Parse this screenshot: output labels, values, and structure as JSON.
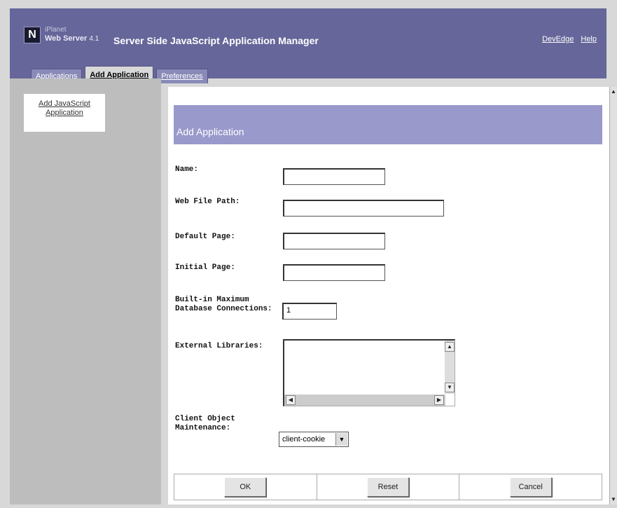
{
  "header": {
    "logo_letter": "N",
    "product_line1": "iPlanet",
    "product_line2": "Web Server",
    "product_version": "4.1",
    "app_title": "Server Side JavaScript Application Manager",
    "links": {
      "devedge": "DevEdge",
      "help": "Help"
    }
  },
  "tabs": [
    {
      "label": "Applications",
      "active": false
    },
    {
      "label": "Add Application",
      "active": true
    },
    {
      "label": "Preferences",
      "active": false
    }
  ],
  "sidebar": {
    "items": [
      {
        "label": "Add JavaScript Application"
      }
    ]
  },
  "form": {
    "banner_title": "Add Application",
    "fields": {
      "name": {
        "label": "Name:",
        "value": ""
      },
      "web_file_path": {
        "label": "Web File Path:",
        "value": ""
      },
      "default_page": {
        "label": "Default Page:",
        "value": ""
      },
      "initial_page": {
        "label": "Initial Page:",
        "value": ""
      },
      "max_db": {
        "label_line1": "Built-in Maximum",
        "label_line2": "Database Connections:",
        "value": "1"
      },
      "external_libraries": {
        "label": "External Libraries:",
        "value": ""
      },
      "client_object": {
        "label_line1": "Client Object",
        "label_line2": "Maintenance:",
        "value": "client-cookie"
      }
    }
  },
  "buttons": {
    "ok": "OK",
    "reset": "Reset",
    "cancel": "Cancel"
  },
  "colors": {
    "header_bg": "#66669a",
    "banner_bg": "#9999cc",
    "sidebar_bg": "#bdbdbd"
  }
}
